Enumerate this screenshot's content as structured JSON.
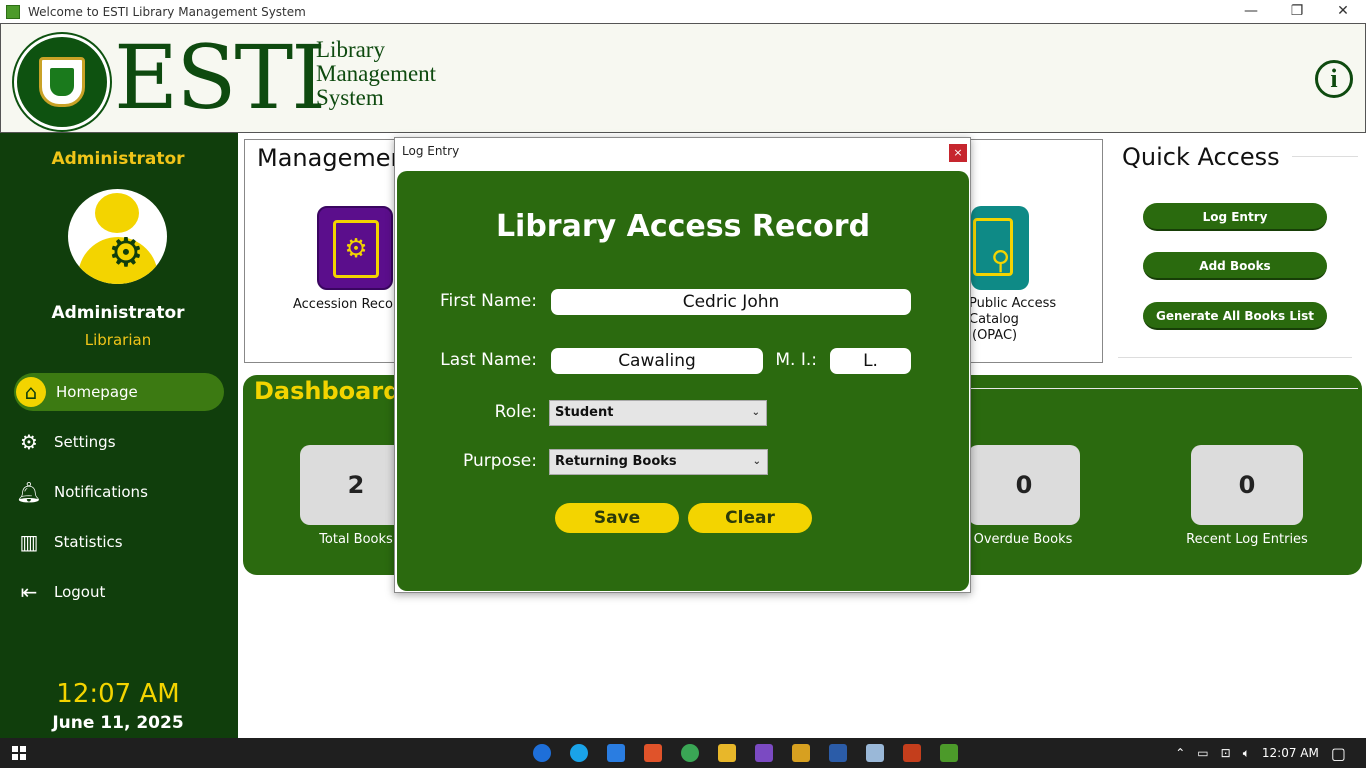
{
  "window": {
    "title": "Welcome to ESTI Library Management System"
  },
  "header": {
    "brand": "ESTI",
    "brand_sub": [
      "Library",
      "Management",
      "System"
    ],
    "info_label": "i"
  },
  "sidebar": {
    "role": "Administrator",
    "name": "Administrator",
    "subtitle": "Librarian",
    "nav": [
      {
        "label": "Homepage",
        "icon": "home-icon",
        "active": true
      },
      {
        "label": "Settings",
        "icon": "gear-icon"
      },
      {
        "label": "Notifications",
        "icon": "bell-icon"
      },
      {
        "label": "Statistics",
        "icon": "chart-icon"
      },
      {
        "label": "Logout",
        "icon": "logout-icon"
      }
    ],
    "time": "12:07 AM",
    "date": "June 11, 2025"
  },
  "management": {
    "title": "Managemen",
    "tiles": [
      {
        "label": "Accession Reco",
        "color": "#5b0e8c",
        "icon": "book-gear-icon"
      },
      {
        "label_lines": [
          "Public Access",
          "Catalog",
          "(OPAC)"
        ],
        "color": "#0e8a86",
        "icon": "book-search-icon"
      }
    ]
  },
  "quick_access": {
    "title": "Quick Access",
    "buttons": [
      "Log Entry",
      "Add Books",
      "Generate All Books List"
    ]
  },
  "dashboard": {
    "title": "Dashboard",
    "stats": [
      {
        "value": "2",
        "label": "Total Books"
      },
      {
        "value": "0",
        "label": "Overdue Books"
      },
      {
        "value": "0",
        "label": "Recent Log Entries"
      }
    ]
  },
  "modal": {
    "title": "Log Entry",
    "close": "×",
    "heading": "Library Access Record",
    "first_name_label": "First Name:",
    "first_name": "Cedric John",
    "last_name_label": "Last Name:",
    "last_name": "Cawaling",
    "mi_label": "M. I.:",
    "mi": "L.",
    "role_label": "Role:",
    "role": "Student",
    "purpose_label": "Purpose:",
    "purpose": "Returning Books",
    "save": "Save",
    "clear": "Clear"
  },
  "taskbar": {
    "time": "12:07 AM"
  },
  "colors": {
    "sidebar": "#103e0c",
    "accent_green": "#2b6a0f",
    "accent_yellow": "#f3d400"
  }
}
